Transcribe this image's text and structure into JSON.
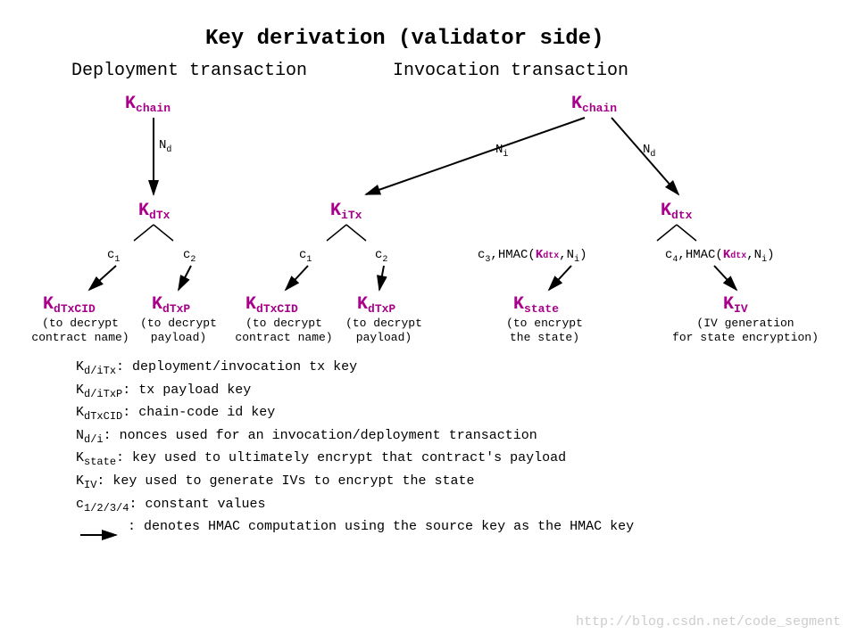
{
  "title": "Key derivation (validator side)",
  "left_title": "Deployment transaction",
  "right_title": "Invocation transaction",
  "keys": {
    "k": "K",
    "chain": "chain",
    "dTx": "dTx",
    "iTx": "iTx",
    "dtx": "dtx",
    "dTxCID": "dTxCID",
    "dTxP": "dTxP",
    "state": "state",
    "iv": "IV"
  },
  "edges": {
    "N": "N",
    "d": "d",
    "i": "i",
    "c": "c",
    "one": "1",
    "two": "2",
    "three": "3",
    "four": "4",
    "hmac_open": ",HMAC(",
    "hmac_mid": ",N",
    "hmac_close": ")"
  },
  "desc": {
    "decrypt_name_1": "(to decrypt",
    "decrypt_name_2": "contract name)",
    "decrypt_payload_1": "(to decrypt",
    "decrypt_payload_2": "payload)",
    "encrypt_state_1": "(to encrypt",
    "encrypt_state_2": "the state)",
    "iv_1": "(IV generation",
    "iv_2": "for state encryption)"
  },
  "legend": {
    "l1a": "K",
    "l1b": "d/iTx",
    "l1c": ": deployment/invocation tx key",
    "l2a": "K",
    "l2b": "d/iTxP",
    "l2c": ": tx payload key",
    "l3a": "K",
    "l3b": "dTxCID",
    "l3c": ": chain-code id key",
    "l4a": "N",
    "l4b": "d/i",
    "l4c": ": nonces used for an invocation/deployment transaction",
    "l5a": "K",
    "l5b": "state",
    "l5c": ": key used to ultimately encrypt that contract's payload",
    "l6a": "K",
    "l6b": "IV",
    "l6c": ": key used to generate IVs to encrypt the state",
    "l7a": "c",
    "l7b": "1/2/3/4",
    "l7c": ": constant values",
    "l8": ": denotes HMAC computation using the source key as the HMAC key"
  },
  "watermark": "http://blog.csdn.net/code_segment"
}
